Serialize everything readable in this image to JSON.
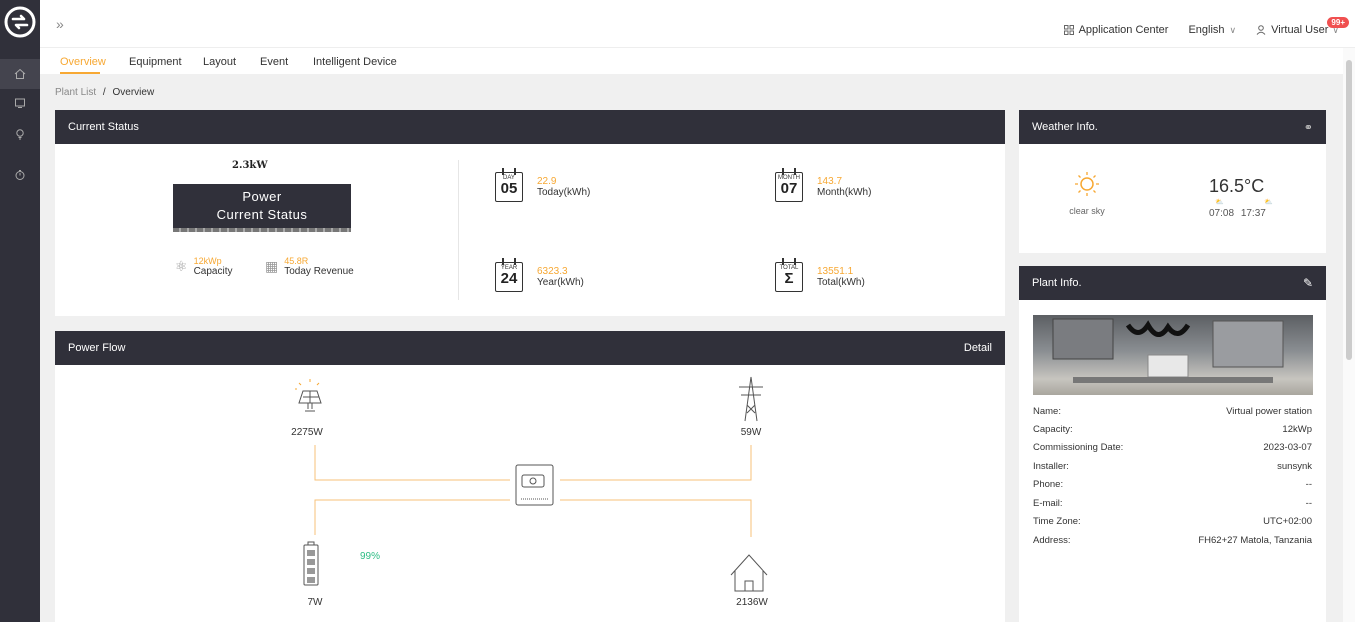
{
  "topbar": {
    "expand_icon": "double-chevron-right-icon",
    "app_center": "Application Center",
    "language": "English",
    "user": "Virtual User",
    "badge": "99+"
  },
  "sidebar": {
    "items": [
      {
        "icon": "home-icon"
      },
      {
        "icon": "monitor-icon"
      },
      {
        "icon": "bulb-icon"
      },
      {
        "icon": "timer-icon"
      }
    ]
  },
  "tabs": [
    "Overview",
    "Equipment",
    "Layout",
    "Event",
    "Intelligent Device"
  ],
  "breadcrumb": {
    "parent": "Plant List",
    "sep": "/",
    "current": "Overview"
  },
  "current_status": {
    "title": "Current Status",
    "power_value": "2.3kW",
    "power_line1": "Power",
    "power_line2": "Current Status",
    "capacity_value": "12kWp",
    "capacity_label": "Capacity",
    "revenue_value": "45.8R",
    "revenue_label": "Today Revenue",
    "stats": [
      {
        "cal_label": "DAY",
        "cal_num": "05",
        "value": "22.9",
        "label": "Today(kWh)"
      },
      {
        "cal_label": "MONTH",
        "cal_num": "07",
        "value": "143.7",
        "label": "Month(kWh)"
      },
      {
        "cal_label": "YEAR",
        "cal_num": "24",
        "value": "6323.3",
        "label": "Year(kWh)"
      },
      {
        "cal_label": "TOTAL",
        "cal_num": "Σ",
        "value": "13551.1",
        "label": "Total(kWh)"
      }
    ]
  },
  "power_flow": {
    "title": "Power Flow",
    "detail": "Detail",
    "solar": "2275W",
    "grid": "59W",
    "battery": "7W",
    "battery_soc": "99%",
    "load": "2136W",
    "colors": {
      "line": "#f7c27a",
      "accent": "#f7a833"
    }
  },
  "weather": {
    "title": "Weather Info.",
    "condition": "clear sky",
    "temp": "16.5°C",
    "sunrise": "07:08",
    "sunset": "17:37"
  },
  "plant": {
    "title": "Plant Info.",
    "rows": [
      {
        "k": "Name:",
        "v": "Virtual power station"
      },
      {
        "k": "Capacity:",
        "v": "12kWp"
      },
      {
        "k": "Commissioning Date:",
        "v": "2023-03-07"
      },
      {
        "k": "Installer:",
        "v": "sunsynk"
      },
      {
        "k": "Phone:",
        "v": "--"
      },
      {
        "k": "E-mail:",
        "v": "--"
      },
      {
        "k": "Time Zone:",
        "v": "UTC+02:00"
      },
      {
        "k": "Address:",
        "v": "FH62+27 Matola, Tanzania"
      }
    ]
  }
}
